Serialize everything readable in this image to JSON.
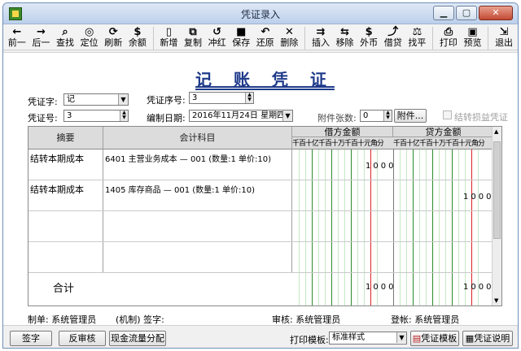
{
  "window": {
    "title": "凭证录入"
  },
  "toolbar": [
    {
      "icon": "←",
      "label": "前一",
      "name": "prev"
    },
    {
      "icon": "→",
      "label": "后一",
      "name": "next"
    },
    {
      "icon": "⌕",
      "label": "查找",
      "name": "find"
    },
    {
      "icon": "◎",
      "label": "定位",
      "name": "locate"
    },
    {
      "icon": "⟳",
      "label": "刷新",
      "name": "refresh"
    },
    {
      "icon": "$",
      "label": "余额",
      "name": "balance"
    },
    {
      "sep": true
    },
    {
      "icon": "▯",
      "label": "新增",
      "name": "new"
    },
    {
      "icon": "⧉",
      "label": "复制",
      "name": "copy"
    },
    {
      "icon": "↺",
      "label": "冲红",
      "name": "reverse"
    },
    {
      "icon": "■",
      "label": "保存",
      "name": "save"
    },
    {
      "icon": "↶",
      "label": "还原",
      "name": "restore"
    },
    {
      "icon": "✕",
      "label": "删除",
      "name": "delete"
    },
    {
      "sep": true
    },
    {
      "icon": "⇉",
      "label": "插入",
      "name": "insert"
    },
    {
      "icon": "⇆",
      "label": "移除",
      "name": "remove"
    },
    {
      "icon": "$",
      "label": "外币",
      "name": "foreign-currency"
    },
    {
      "icon": "⤴",
      "label": "借贷",
      "name": "debit-credit"
    },
    {
      "icon": "⚖",
      "label": "找平",
      "name": "balance-entry"
    },
    {
      "sep": true
    },
    {
      "icon": "⎙",
      "label": "打印",
      "name": "print"
    },
    {
      "icon": "▣",
      "label": "预览",
      "name": "preview"
    },
    {
      "sep": true
    },
    {
      "icon": "⇲",
      "label": "退出",
      "name": "exit"
    }
  ],
  "voucher": {
    "title": "记 账 凭 证",
    "type_label": "凭证字:",
    "type_value": "记",
    "seq_label": "凭证序号:",
    "seq_value": "3",
    "no_label": "凭证号:",
    "no_value": "3",
    "date_label": "编制日期:",
    "date_value": "2016年11月24日 星期四",
    "attach_label": "附件张数:",
    "attach_value": "0",
    "attach_button": "附件...",
    "transfer_label": "结转损益凭证"
  },
  "grid": {
    "col_summary": "摘要",
    "col_account": "会计科目",
    "col_debit": "借方金额",
    "col_credit": "贷方金额",
    "digit_headers": [
      "千",
      "百",
      "十",
      "亿",
      "千",
      "百",
      "十",
      "万",
      "千",
      "百",
      "十",
      "元",
      "角",
      "分"
    ],
    "rows": [
      {
        "summary": "结转本期成本",
        "account": "6401  主营业务成本 — 001 (数量:1 单价:10)",
        "debit": "1000",
        "credit": ""
      },
      {
        "summary": "结转本期成本",
        "account": "1405  库存商品 — 001 (数量:1 单价:10)",
        "debit": "",
        "credit": "1000"
      },
      {
        "summary": "",
        "account": "",
        "debit": "",
        "credit": ""
      },
      {
        "summary": "",
        "account": "",
        "debit": "",
        "credit": ""
      }
    ],
    "total_label": "合计",
    "total_debit": "1000",
    "total_credit": "1000"
  },
  "footer": {
    "maker": "制单: 系统管理员",
    "agency": "(机制)  签字:",
    "auditor": "审核: 系统管理员",
    "poster": "登帐: 系统管理员"
  },
  "bottom": {
    "sign_button": "签字",
    "unaudit_button": "反审核",
    "cashflow_button": "现金流量分配",
    "print_template_label": "打印模板:",
    "print_template_value": "标准样式",
    "template_button": "凭证模板",
    "help_button": "凭证说明"
  }
}
